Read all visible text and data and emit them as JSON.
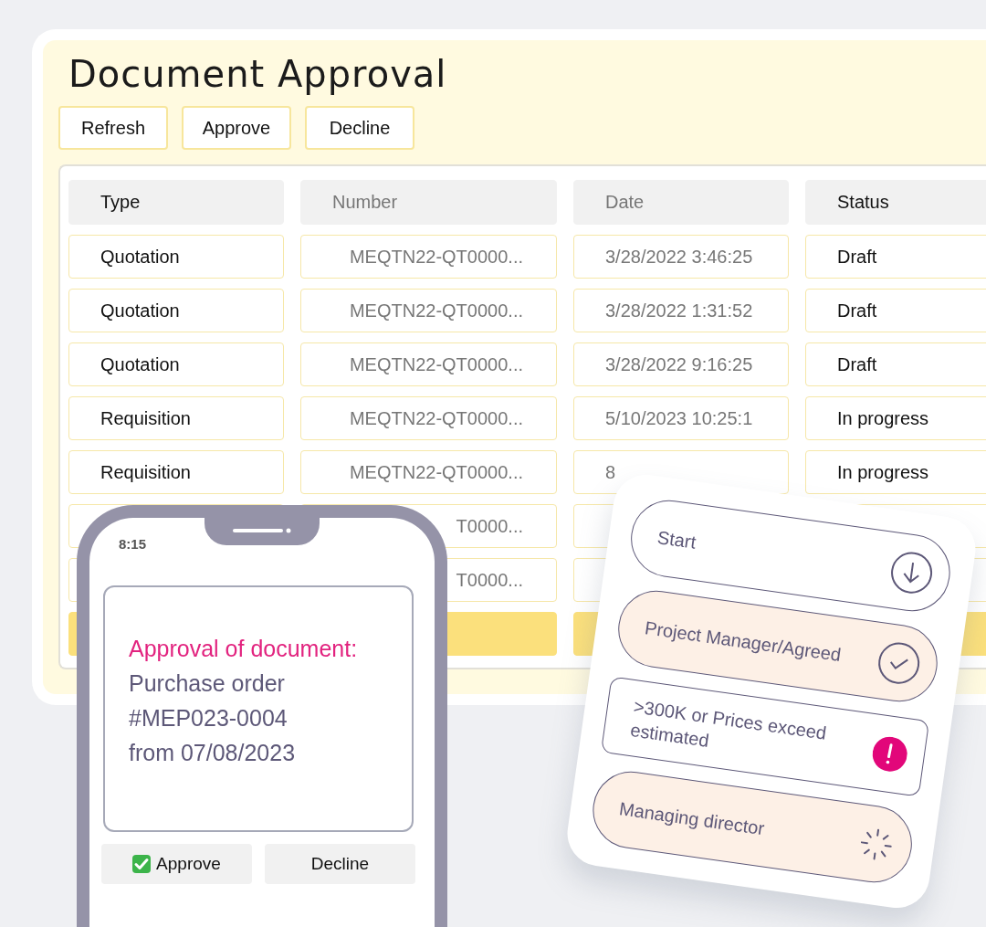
{
  "window": {
    "title": "Document Approval"
  },
  "toolbar": [
    {
      "label": "Refresh"
    },
    {
      "label": "Approve"
    },
    {
      "label": "Decline"
    }
  ],
  "table": {
    "columns": [
      {
        "label": "Type",
        "kind": "primary"
      },
      {
        "label": "Number",
        "kind": "secondary"
      },
      {
        "label": "Date",
        "kind": "secondary"
      },
      {
        "label": "Status",
        "kind": "primary"
      }
    ],
    "rows": [
      {
        "type": "Quotation",
        "number": "MEQTN22-QT0000...",
        "date": "3/28/2022 3:46:25",
        "status": "Draft",
        "highlighted": false
      },
      {
        "type": "Quotation",
        "number": "MEQTN22-QT0000...",
        "date": "3/28/2022 1:31:52",
        "status": "Draft",
        "highlighted": false
      },
      {
        "type": "Quotation",
        "number": "MEQTN22-QT0000...",
        "date": "3/28/2022 9:16:25",
        "status": "Draft",
        "highlighted": false
      },
      {
        "type": "Requisition",
        "number": "MEQTN22-QT0000...",
        "date": "5/10/2023 10:25:1",
        "status": "In progress",
        "highlighted": false
      },
      {
        "type": "Requisition",
        "number": "MEQTN22-QT0000...",
        "date": "8",
        "status": "In progress",
        "highlighted": false
      },
      {
        "number": "T0000...",
        "highlighted": false
      },
      {
        "number": "T0000...",
        "highlighted": false
      },
      {
        "highlighted": true
      }
    ]
  },
  "phone": {
    "time": "8:15",
    "message": {
      "heading": "Approval of document:",
      "lines": [
        "Purchase order",
        "#MEP023-0004",
        "from 07/08/2023"
      ]
    },
    "buttons": [
      {
        "label": "Approve",
        "kind": "approve"
      },
      {
        "label": "Decline",
        "kind": "plain"
      }
    ]
  },
  "workflow": {
    "steps": [
      {
        "label": "Start",
        "kind": "start"
      },
      {
        "label": "Project Manager/Agreed",
        "kind": "agreed"
      },
      {
        "label": ">300K or Prices exceed estimated",
        "kind": "alert"
      },
      {
        "label": "Managing director",
        "kind": "waiting"
      }
    ]
  }
}
